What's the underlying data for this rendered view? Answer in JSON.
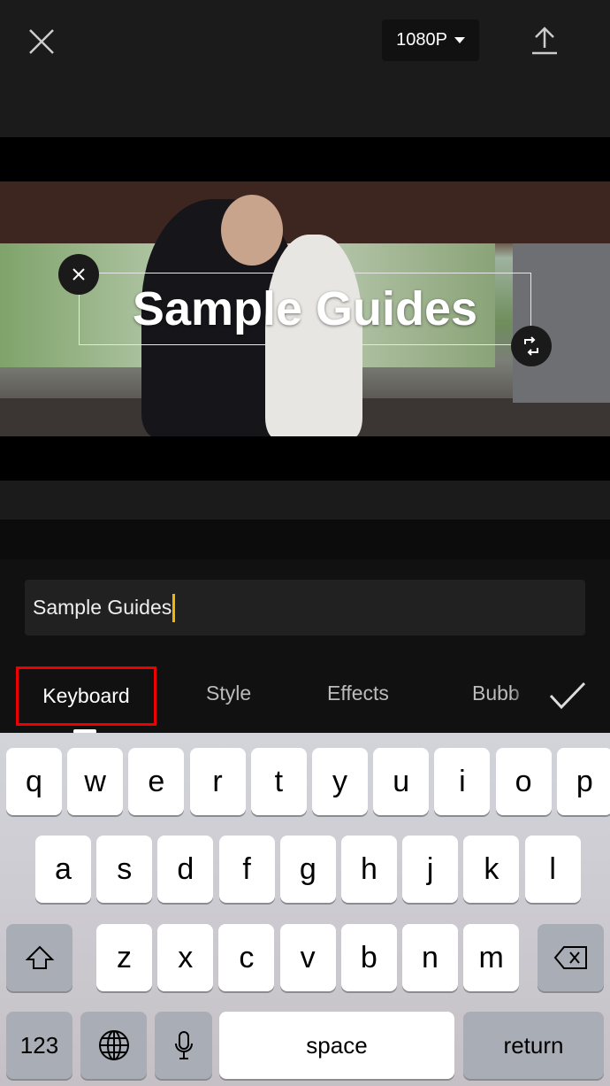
{
  "header": {
    "resolution": "1080P",
    "close_icon": "close-icon",
    "export_icon": "upload-icon"
  },
  "preview": {
    "overlay_text": "Sample Guides"
  },
  "editor": {
    "input_value": "Sample Guides",
    "accent_color": "#f5b400"
  },
  "tabs": [
    {
      "label": "Keyboard",
      "selected": true
    },
    {
      "label": "Style"
    },
    {
      "label": "Effects"
    },
    {
      "label": "Bubb"
    }
  ],
  "keyboard": {
    "row1": [
      "q",
      "w",
      "e",
      "r",
      "t",
      "y",
      "u",
      "i",
      "o",
      "p"
    ],
    "row2": [
      "a",
      "s",
      "d",
      "f",
      "g",
      "h",
      "j",
      "k",
      "l"
    ],
    "row3": [
      "z",
      "x",
      "c",
      "v",
      "b",
      "n",
      "m"
    ],
    "numbers_label": "123",
    "space_label": "space",
    "return_label": "return"
  }
}
